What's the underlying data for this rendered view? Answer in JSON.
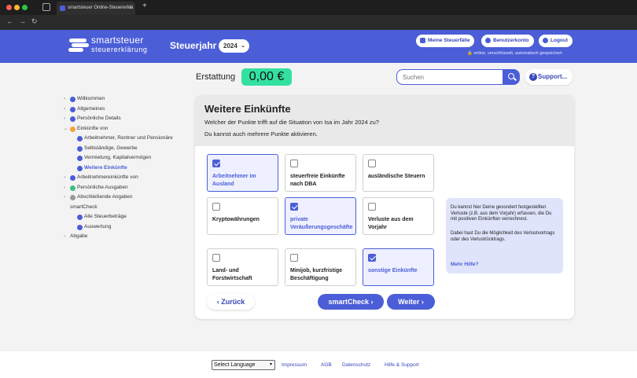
{
  "browser": {
    "tab_title": "smartsteuer Online-Steuererklä",
    "tab_close": "×",
    "new_tab": "+",
    "back": "←",
    "forward": "→",
    "reload": "↻"
  },
  "header": {
    "brand": "smartsteuer",
    "brand_sub": "steuererklärung",
    "steuerjahr_label": "Steuerjahr",
    "year": "2024",
    "buttons": {
      "steuerfaelle": "Meine Steuerfälle",
      "benutzerkonto": "Benutzerkonto",
      "logout": "Logout"
    },
    "secure_text": "🔒 online, verschlüsselt, automatisch gespeichert"
  },
  "topbar": {
    "erstattung_label": "Erstattung",
    "erstattung_value": "0,00 €",
    "search_placeholder": "Suchen",
    "support_label": "Support..."
  },
  "sidebar": {
    "items": [
      {
        "label": "Willkommen",
        "arrow": "›",
        "status": "done"
      },
      {
        "label": "Allgemeines",
        "arrow": "›",
        "status": "done"
      },
      {
        "label": "Persönliche Details",
        "arrow": "›",
        "status": "done"
      },
      {
        "label": "Einkünfte von",
        "arrow": "⌄",
        "status": "warn"
      },
      {
        "label": "Arbeitnehmer, Rentner und Pensionäre",
        "status": "done"
      },
      {
        "label": "Selbständige, Gewerbe",
        "status": "done"
      },
      {
        "label": "Vermietung, Kapitalvermögen",
        "status": "done"
      },
      {
        "label": "Weitere Einkünfte",
        "status": "done"
      },
      {
        "label": "Arbeitnehmereinkünfte von",
        "arrow": "›",
        "status": "done"
      },
      {
        "label": "Persönliche Ausgaben",
        "arrow": "›",
        "status": "part"
      },
      {
        "label": "Abschließende Angaben",
        "arrow": "›",
        "status": "grey"
      },
      {
        "label": "smartCheck"
      },
      {
        "label": "Alle Steuerbeträge",
        "status": "done"
      },
      {
        "label": "Auswertung",
        "status": "done"
      },
      {
        "label": "Abgabe",
        "arrow": "›"
      }
    ]
  },
  "card": {
    "title": "Weitere Einkünfte",
    "question": "Welcher der Punkte trifft auf die Situation von Isa im Jahr 2024 zu?",
    "hint": "Du kannst auch mehrere Punkte aktivieren.",
    "options": [
      {
        "label": "Arbeitnehmer im Ausland",
        "checked": true
      },
      {
        "label": "steuerfreie Einkünfte nach DBA",
        "checked": false
      },
      {
        "label": "ausländische Steuern",
        "checked": false
      },
      {
        "label": "Kryptowährungen",
        "checked": false
      },
      {
        "label": "private Veräußerungsgeschäfte",
        "checked": true
      },
      {
        "label": "Verluste aus dem Vorjahr",
        "checked": false
      },
      {
        "label": "Land- und Forstwirtschaft",
        "checked": false
      },
      {
        "label": "Minijob, kurzfristige Beschäftigung",
        "checked": false
      },
      {
        "label": "sonstige Einkünfte",
        "checked": true
      }
    ],
    "info": {
      "p1": "Du kannst hier Deine gesondert festgestellten Verluste (z.B. aus dem Vorjahr) erfassen, die Du mit positiven Einkünften verrechnest.",
      "p2": "Dabei hast Du die Möglichkeit des Verlustvortrags oder des Verlustrücktrags.",
      "more": "Mehr Hilfe?"
    },
    "buttons": {
      "back": "‹ Zurück",
      "smartcheck": "smartCheck ›",
      "next": "Weiter ›"
    }
  },
  "footer": {
    "language": "Select Language",
    "links": [
      "Impressum",
      "AGB",
      "Datenschutz",
      "Hilfe & Support"
    ]
  },
  "colors": {
    "brand": "#4b5ed7",
    "refund": "#33e0a0"
  }
}
